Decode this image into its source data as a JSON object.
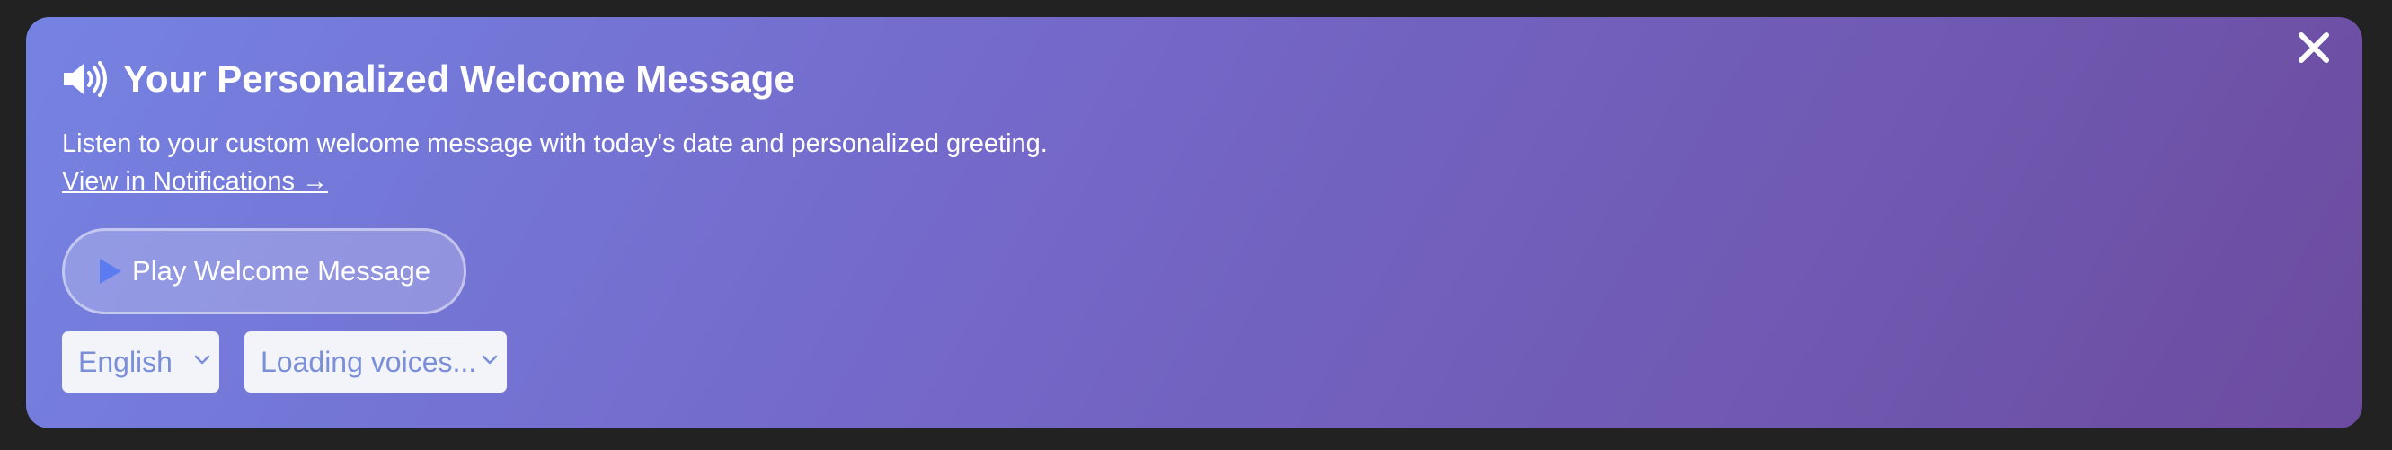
{
  "banner": {
    "title": "Your Personalized Welcome Message",
    "description": "Listen to your custom welcome message with today's date and personalized greeting.",
    "link_text": "View in Notifications →",
    "play_button_label": "Play Welcome Message",
    "language_select": {
      "selected": "English"
    },
    "voice_select": {
      "selected": "Loading voices..."
    },
    "icons": {
      "title": "speaker-volume-icon",
      "play": "play-icon",
      "close": "close-icon",
      "dropdown": "chevron-down-icon"
    }
  },
  "colors": {
    "background": "#222222",
    "gradient_start": "#7583e2",
    "gradient_end": "#6c4b9f",
    "text": "#ffffff",
    "play_icon": "#5b7cf0",
    "select_text": "#7b8fd8"
  }
}
